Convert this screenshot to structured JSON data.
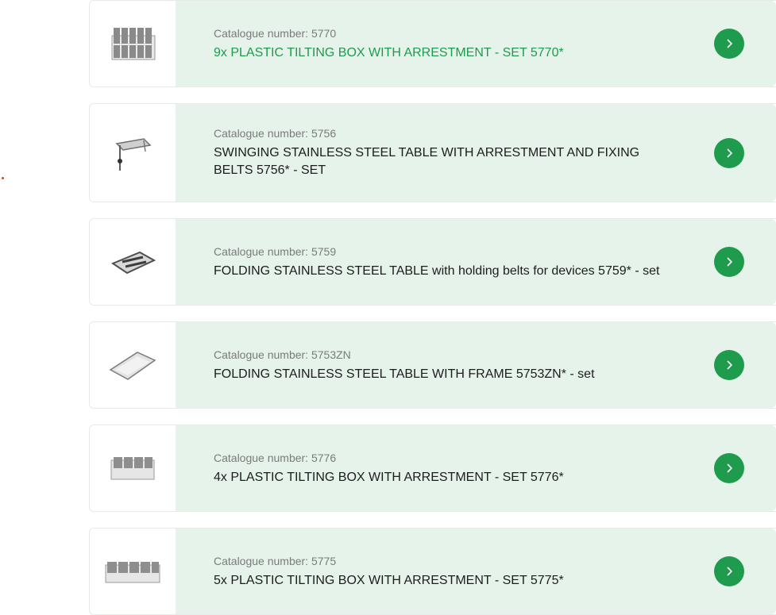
{
  "catalogue_prefix": "Catalogue number: ",
  "products": [
    {
      "catalogue_label": "Catalogue number: 5770",
      "title": "9x PLASTIC TILTING BOX WITH ARRESTMENT - SET 5770*",
      "image_icon": "plastic-box-set-icon",
      "active": true
    },
    {
      "catalogue_label": "Catalogue number: 5756",
      "title": "SWINGING STAINLESS STEEL TABLE WITH ARRESTMENT AND FIXING BELTS 5756* - SET",
      "image_icon": "swinging-table-icon",
      "active": false
    },
    {
      "catalogue_label": "Catalogue number: 5759",
      "title": "FOLDING STAINLESS STEEL TABLE with holding belts for devices 5759* - set",
      "image_icon": "folding-table-belts-icon",
      "active": false
    },
    {
      "catalogue_label": "Catalogue number: 5753ZN",
      "title": "FOLDING STAINLESS STEEL TABLE WITH FRAME 5753ZN* - set",
      "image_icon": "folding-table-frame-icon",
      "active": false
    },
    {
      "catalogue_label": "Catalogue number: 5776",
      "title": "4x PLASTIC TILTING BOX WITH ARRESTMENT - SET 5776*",
      "image_icon": "plastic-box-set-icon",
      "active": false
    },
    {
      "catalogue_label": "Catalogue number: 5775",
      "title": "5x PLASTIC TILTING BOX WITH ARRESTMENT - SET 5775*",
      "image_icon": "plastic-box-set-icon",
      "active": false
    }
  ],
  "colors": {
    "accent": "#1e9b4c",
    "card_background": "#e6f3ea",
    "catalogue_text": "#7b7b7b",
    "title_text": "#1d1d1d"
  },
  "arrow_icon": "chevron-right-icon"
}
